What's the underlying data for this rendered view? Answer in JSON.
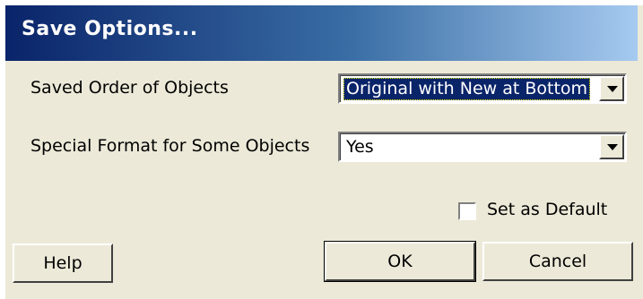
{
  "window": {
    "title": "Save Options..."
  },
  "fields": {
    "saved_order_label": "Saved Order of Objects",
    "saved_order_value": "Original with New at Bottom",
    "special_format_label": "Special Format for Some Objects",
    "special_format_value": "Yes"
  },
  "checkbox": {
    "label": "Set as Default",
    "checked": false
  },
  "buttons": {
    "help": "Help",
    "ok": "OK",
    "cancel": "Cancel"
  },
  "colors": {
    "title_bar_start": "#0a246a",
    "title_bar_end": "#a6caf0",
    "dialog_face": "#ece9d8",
    "selection": "#0a246a"
  }
}
